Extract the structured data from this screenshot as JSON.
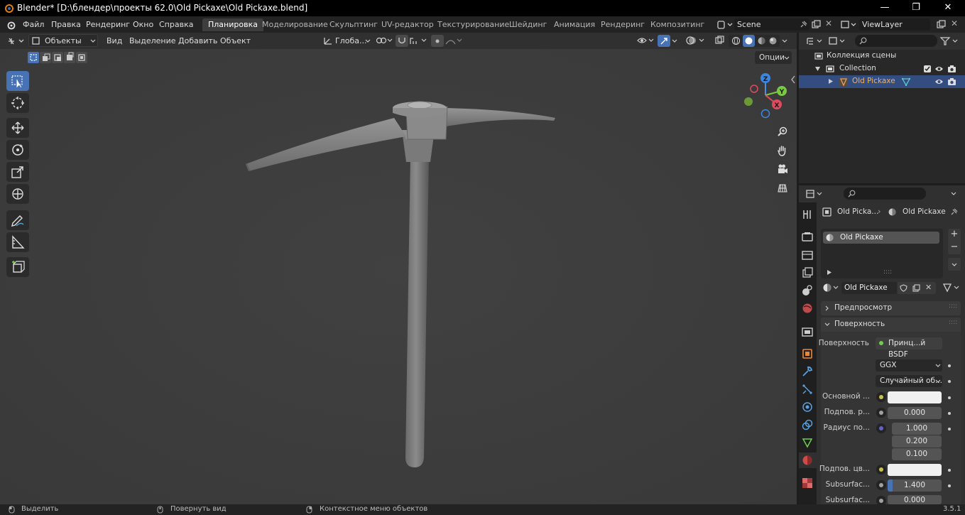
{
  "window": {
    "title": "Blender* [D:\\блендер\\проекты 62.0\\Old Pickaxe\\Old Pickaxe.blend]",
    "minimize": "—",
    "maximize": "❐",
    "close": "✕"
  },
  "menu": [
    "Файл",
    "Правка",
    "Рендеринг",
    "Окно",
    "Справка"
  ],
  "workspaces": [
    "Планировка",
    "Моделирование",
    "Скульптинг",
    "UV-редактор",
    "Текстурирование",
    "Шейдинг",
    "Анимация",
    "Рендеринг",
    "Композитинг"
  ],
  "scene": {
    "name": "Scene",
    "view_layer": "ViewLayer"
  },
  "viewport": {
    "mode": "Объекты",
    "menu": [
      "Вид",
      "Выделение",
      "Добавить",
      "Объект"
    ],
    "orientation": "Глоба...",
    "options": "Опции",
    "gizmo": {
      "z": "Z",
      "y": "Y",
      "x": "X"
    }
  },
  "outliner": {
    "scene_collection": "Коллекция сцены",
    "collection": "Collection",
    "object": "Old Pickaxe"
  },
  "properties": {
    "breadcrumb_obj": "Old Picka...",
    "breadcrumb_mat": "Old Pickaxe",
    "slot": "Old Pickaxe",
    "material_name": "Old Pickaxe",
    "panel_preview": "Предпросмотр",
    "panel_surface": "Поверхность",
    "surface_label": "Поверхность",
    "surface_value": "Принц...й BSDF",
    "distribution": "GGX",
    "subsurface_method": "Случайный об...",
    "rows": [
      {
        "label": "Основной ...",
        "value": "",
        "dot": "#c8c04a",
        "kind": "color"
      },
      {
        "label": "Подпов. р...",
        "value": "0.000",
        "dot": "#a0a0a0",
        "kind": "num"
      },
      {
        "label": "Радиус по...",
        "value": "1.000",
        "dot": "#6363c7",
        "kind": "num"
      },
      {
        "label": "",
        "value": "0.200",
        "dot": "",
        "kind": "num"
      },
      {
        "label": "",
        "value": "0.100",
        "dot": "",
        "kind": "num"
      },
      {
        "label": "Подпов. цв...",
        "value": "",
        "dot": "#c8c04a",
        "kind": "color"
      },
      {
        "label": "Subsurfac...",
        "value": "1.400",
        "dot": "#a0a0a0",
        "kind": "slider"
      },
      {
        "label": "Subsurfac...",
        "value": "0.000",
        "dot": "#a0a0a0",
        "kind": "num"
      }
    ]
  },
  "status": {
    "select": "Выделить",
    "rotate": "Повернуть вид",
    "context": "Контекстное меню объектов",
    "version": "3.5.1"
  }
}
